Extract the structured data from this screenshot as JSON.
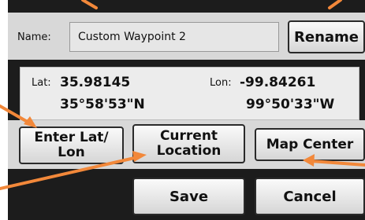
{
  "name_label": "Name:",
  "name_value": "Custom Waypoint 2",
  "buttons": {
    "rename": "Rename",
    "enter_latlon_line1": "Enter Lat/",
    "enter_latlon_line2": "Lon",
    "current_location_line1": "Current",
    "current_location_line2": "Location",
    "map_center": "Map Center",
    "save": "Save",
    "cancel": "Cancel"
  },
  "coordinates": {
    "lat_label": "Lat:",
    "lat_decimal": "35.98145",
    "lat_dms": "35°58'53\"N",
    "lon_label": "Lon:",
    "lon_decimal": "-99.84261",
    "lon_dms": "99°50'33\"W"
  },
  "colors": {
    "annotation_arrow": "#f2883a",
    "dialog_background": "#1c1c1c"
  }
}
